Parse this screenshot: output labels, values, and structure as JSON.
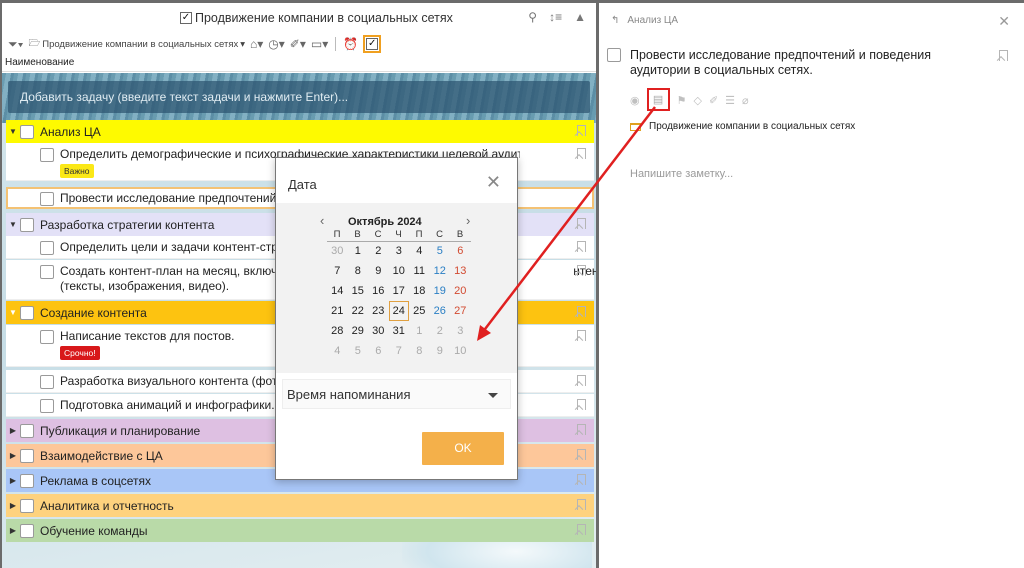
{
  "app": {
    "title": "Продвижение компании в социальных сетях"
  },
  "toolbar": {
    "project_label": "Продвижение компании в социальных сетях"
  },
  "column_header": "Наименование",
  "add_task": {
    "placeholder": "Добавить задачу (введите текст задачи и нажмите Enter)..."
  },
  "groups": [
    {
      "label": "Анализ ЦА",
      "color": "#fefa00"
    },
    {
      "label": "Разработка стратегии контента",
      "color": "#e3e1f7"
    },
    {
      "label": "Создание контента",
      "color": "#fdc310"
    },
    {
      "label": "Публикация и планирование",
      "color": "#dec0e2"
    },
    {
      "label": "Взаимодействие с ЦА",
      "color": "#fdc79a"
    },
    {
      "label": "Реклама в соцсетях",
      "color": "#a9c6f7"
    },
    {
      "label": "Аналитика и отчетность",
      "color": "#fed27e"
    },
    {
      "label": "Обучение команды",
      "color": "#b9daa8"
    }
  ],
  "tasks": {
    "t1": {
      "line1": "Определить демографические и психографические характеристики целевой аудитории",
      "tag": "Важно"
    },
    "t2": {
      "line1": "Провести исследование предпочтений и п"
    },
    "t3": {
      "line1": "Определить цели и задачи контент-страте"
    },
    "t4": {
      "line1": "Создать контент-план на месяц, включая т",
      "line1_tail": "нтента",
      "line2": "(тексты, изображения, видео)."
    },
    "t5": {
      "line1": "Написание текстов для постов.",
      "tag": "Срочно!"
    },
    "t6": {
      "line1": "Разработка визуального контента (фотогр"
    },
    "t7": {
      "line1": "Подготовка анимаций и инфографики."
    }
  },
  "date_popup": {
    "title": "Дата",
    "month": "Октябрь 2024",
    "weekdays": [
      "П",
      "В",
      "С",
      "Ч",
      "П",
      "С",
      "В"
    ],
    "weeks": [
      [
        "30",
        "1",
        "2",
        "3",
        "4",
        "5",
        "6"
      ],
      [
        "7",
        "8",
        "9",
        "10",
        "11",
        "12",
        "13"
      ],
      [
        "14",
        "15",
        "16",
        "17",
        "18",
        "19",
        "20"
      ],
      [
        "21",
        "22",
        "23",
        "24",
        "25",
        "26",
        "27"
      ],
      [
        "28",
        "29",
        "30",
        "31",
        "1",
        "2",
        "3"
      ],
      [
        "4",
        "5",
        "6",
        "7",
        "8",
        "9",
        "10"
      ]
    ],
    "today": "24",
    "reminder_label": "Время напоминания",
    "ok_label": "OK"
  },
  "detail": {
    "crumb": "Анализ ЦА",
    "task_title": "Провести исследование предпочтений и поведения аудитории в социальных сетях.",
    "project": "Продвижение компании в социальных сетях",
    "note_placeholder": "Напишите заметку..."
  },
  "colors": {
    "accent_orange": "#f4b04a",
    "highlight_red": "#e02020",
    "saturday": "#2a7fc4",
    "sunday": "#d24a30"
  }
}
